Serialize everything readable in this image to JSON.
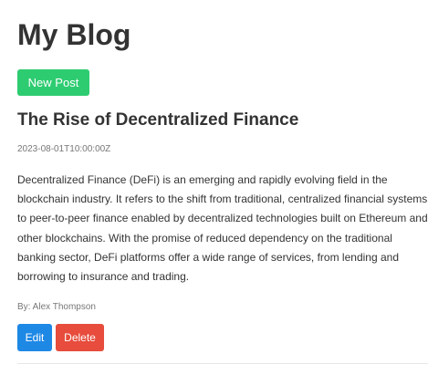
{
  "blog": {
    "title": "My Blog",
    "new_post_label": "New Post"
  },
  "post": {
    "title": "The Rise of Decentralized Finance",
    "date": "2023-08-01T10:00:00Z",
    "body": "Decentralized Finance (DeFi) is an emerging and rapidly evolving field in the blockchain industry. It refers to the shift from traditional, centralized financial systems to peer-to-peer finance enabled by decentralized technologies built on Ethereum and other blockchains. With the promise of reduced dependency on the traditional banking sector, DeFi platforms offer a wide range of services, from lending and borrowing to insurance and trading.",
    "author": "By: Alex Thompson",
    "edit_label": "Edit",
    "delete_label": "Delete"
  },
  "colors": {
    "new_post_button": "#2ecc71",
    "edit_button": "#1e88e5",
    "delete_button": "#e74c3c",
    "text": "#333333",
    "meta_text": "#777777"
  }
}
